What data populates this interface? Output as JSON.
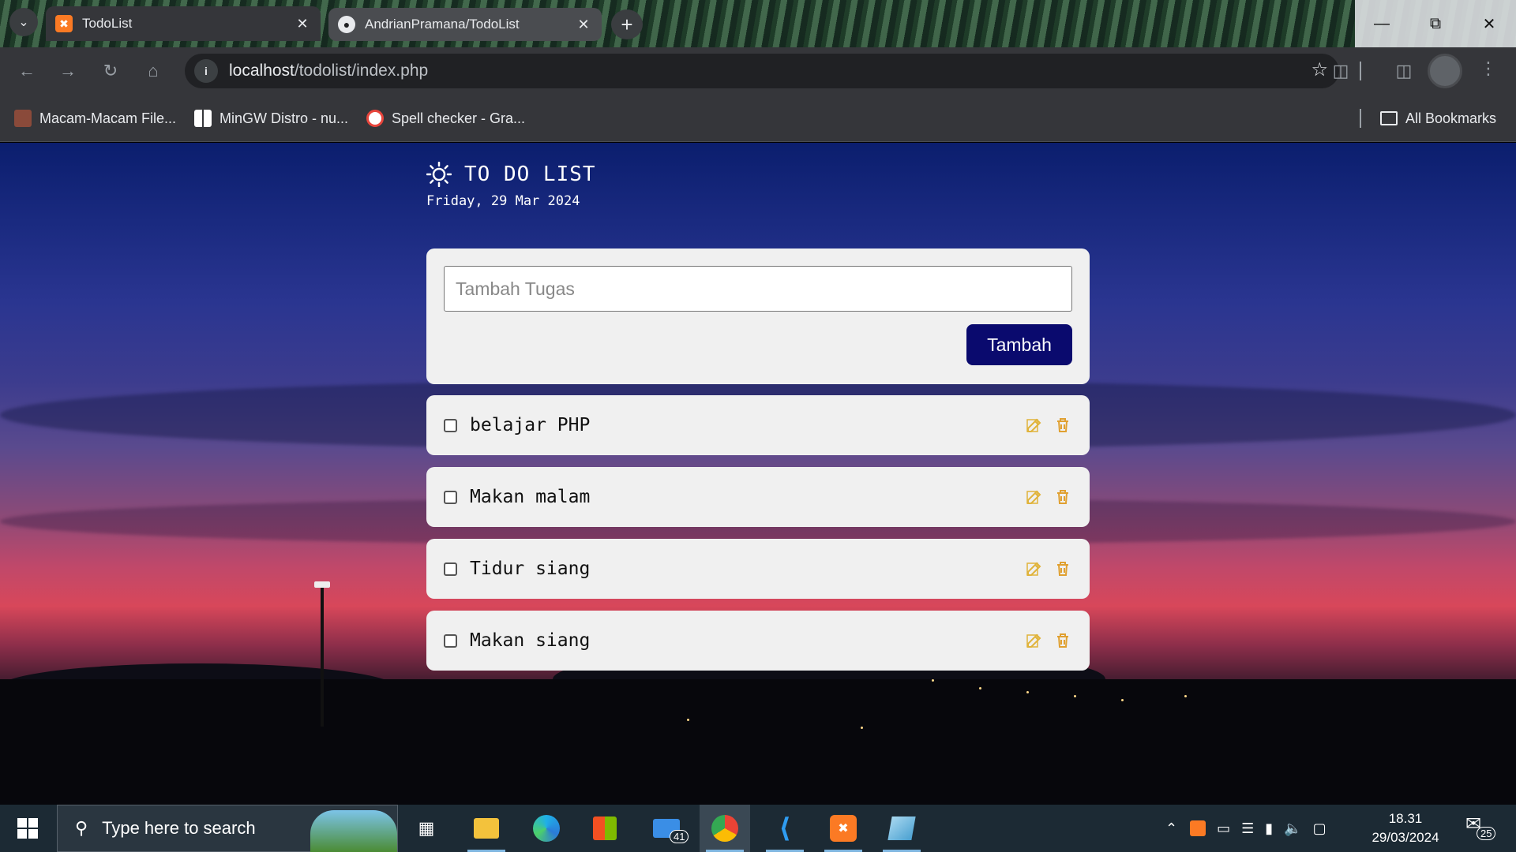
{
  "browser": {
    "tabs": [
      {
        "title": "TodoList",
        "favicon": "xampp-icon",
        "active": true
      },
      {
        "title": "AndrianPramana/TodoList",
        "favicon": "github-icon",
        "active": false
      }
    ],
    "url_host": "localhost",
    "url_path": "/todolist/index.php",
    "bookmarks": [
      {
        "label": "Macam-Macam File...",
        "icon": "avatar-icon"
      },
      {
        "label": "MinGW Distro - nu...",
        "icon": "windows-grid-icon"
      },
      {
        "label": "Spell checker - Gra...",
        "icon": "chat-bubble-icon"
      }
    ],
    "all_bookmarks_label": "All Bookmarks"
  },
  "app": {
    "title": "TO DO LIST",
    "date": "Friday, 29 Mar 2024",
    "input_placeholder": "Tambah Tugas",
    "add_button_label": "Tambah",
    "tasks": [
      {
        "label": "belajar PHP",
        "done": false
      },
      {
        "label": "Makan malam",
        "done": false
      },
      {
        "label": "Tidur siang",
        "done": false
      },
      {
        "label": "Makan siang",
        "done": false
      }
    ],
    "colors": {
      "primary_button": "#0a0a6e",
      "edit_icon": "#e0b33a",
      "delete_icon": "#e0a030"
    }
  },
  "taskbar": {
    "search_placeholder": "Type here to search",
    "mail_badge": "41",
    "time": "18.31",
    "date": "29/03/2024",
    "notification_count": "25"
  }
}
